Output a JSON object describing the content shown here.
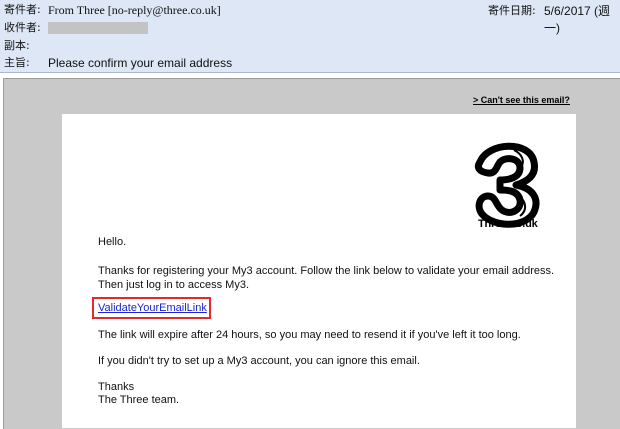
{
  "header": {
    "from_label": "寄件者:",
    "from_value": "From Three [no-reply@three.co.uk]",
    "to_label": "收件者:",
    "cc_label": "副本:",
    "subject_label": "主旨:",
    "subject_value": "Please confirm your email address",
    "date_label": "寄件日期:",
    "date_value": "5/6/2017 (週一)"
  },
  "email": {
    "cant_see": "> Can't see this email?",
    "logo_text": "Three.co.uk",
    "greeting": "Hello.",
    "thanks_line1": "Thanks for registering your My3 account. Follow the link below to validate your email address.",
    "thanks_line2": "Then just log in to access My3.",
    "validate_link": "ValidateYourEmailLink",
    "expire_line": "The link will expire after 24 hours, so you may need to resend it if you've left it too long.",
    "ignore_line": "If you didn't try to set up a My3 account, you can ignore this email.",
    "signoff1": "Thanks",
    "signoff2": "The Three team."
  },
  "colors": {
    "header_bg": "#dde7f5",
    "frame_bg": "#c9c9c9",
    "link": "#1a24d0",
    "highlight_box": "#e32a2a"
  }
}
